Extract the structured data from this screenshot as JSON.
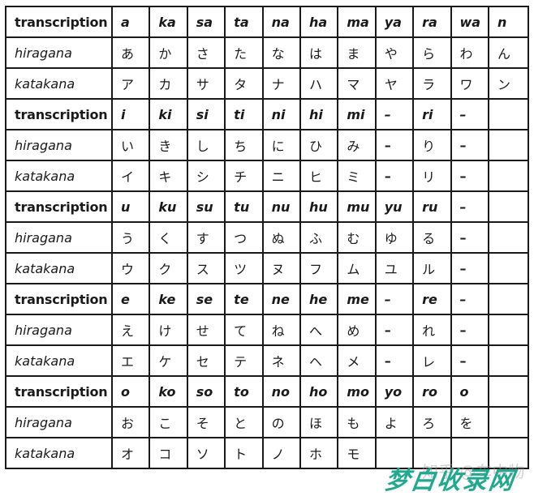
{
  "columns": [
    "a-col",
    "ka-col",
    "sa-col",
    "ta-col",
    "na-col",
    "ha-col",
    "ma-col",
    "ya-col",
    "ra-col",
    "wa-col",
    "n-col"
  ],
  "groups": [
    {
      "vowel": "a",
      "transcription_label": "transcription",
      "hiragana_label": "hiragana",
      "katakana_label": "katakana",
      "transcription": [
        "a",
        "ka",
        "sa",
        "ta",
        "na",
        "ha",
        "ma",
        "ya",
        "ra",
        "wa",
        "n"
      ],
      "hiragana": [
        "あ",
        "か",
        "さ",
        "た",
        "な",
        "は",
        "ま",
        "や",
        "ら",
        "わ",
        "ん"
      ],
      "katakana": [
        "ア",
        "カ",
        "サ",
        "タ",
        "ナ",
        "ハ",
        "マ",
        "ヤ",
        "ラ",
        "ワ",
        "ン"
      ]
    },
    {
      "vowel": "i",
      "transcription_label": "transcription",
      "hiragana_label": "hiragana",
      "katakana_label": "katakana",
      "transcription": [
        "i",
        "ki",
        "si",
        "ti",
        "ni",
        "hi",
        "mi",
        "–",
        "ri",
        "–",
        ""
      ],
      "hiragana": [
        "い",
        "き",
        "し",
        "ち",
        "に",
        "ひ",
        "み",
        "–",
        "り",
        "–",
        ""
      ],
      "katakana": [
        "イ",
        "キ",
        "シ",
        "チ",
        "ニ",
        "ヒ",
        "ミ",
        "–",
        "リ",
        "–",
        ""
      ]
    },
    {
      "vowel": "u",
      "transcription_label": "transcription",
      "hiragana_label": "hiragana",
      "katakana_label": "katakana",
      "transcription": [
        "u",
        "ku",
        "su",
        "tu",
        "nu",
        "hu",
        "mu",
        "yu",
        "ru",
        "–",
        ""
      ],
      "hiragana": [
        "う",
        "く",
        "す",
        "つ",
        "ぬ",
        "ふ",
        "む",
        "ゆ",
        "る",
        "–",
        ""
      ],
      "katakana": [
        "ウ",
        "ク",
        "ス",
        "ツ",
        "ヌ",
        "フ",
        "ム",
        "ユ",
        "ル",
        "–",
        ""
      ]
    },
    {
      "vowel": "e",
      "transcription_label": "transcription",
      "hiragana_label": "hiragana",
      "katakana_label": "katakana",
      "transcription": [
        "e",
        "ke",
        "se",
        "te",
        "ne",
        "he",
        "me",
        "–",
        "re",
        "–",
        ""
      ],
      "hiragana": [
        "え",
        "け",
        "せ",
        "て",
        "ね",
        "へ",
        "め",
        "–",
        "れ",
        "–",
        ""
      ],
      "katakana": [
        "エ",
        "ケ",
        "セ",
        "テ",
        "ネ",
        "ヘ",
        "メ",
        "–",
        "レ",
        "–",
        ""
      ]
    },
    {
      "vowel": "o",
      "transcription_label": "transcription",
      "hiragana_label": "hiragana",
      "katakana_label": "katakana",
      "transcription": [
        "o",
        "ko",
        "so",
        "to",
        "no",
        "ho",
        "mo",
        "yo",
        "ro",
        "o",
        ""
      ],
      "hiragana": [
        "お",
        "こ",
        "そ",
        "と",
        "の",
        "ほ",
        "も",
        "よ",
        "ろ",
        "を",
        ""
      ],
      "katakana": [
        "オ",
        "コ",
        "ソ",
        "ト",
        "ノ",
        "ホ",
        "モ",
        "",
        "",
        "",
        ""
      ]
    }
  ],
  "watermark": {
    "main": "梦白收录网",
    "faint": "知乎 @车中物"
  }
}
